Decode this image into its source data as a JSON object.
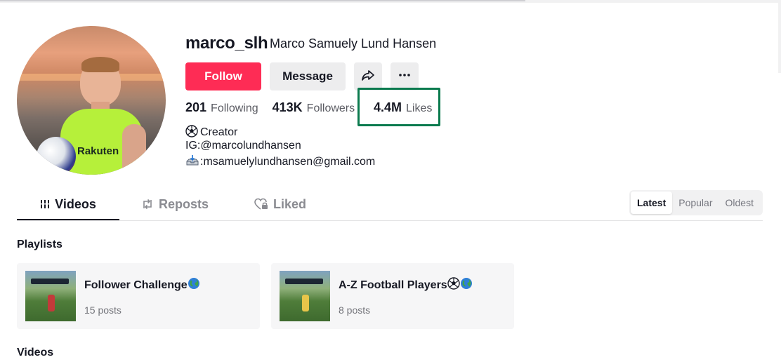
{
  "profile": {
    "username": "marco_slh",
    "display_name": "Marco Samuely Lund Hansen",
    "buttons": {
      "follow": "Follow",
      "message": "Message"
    },
    "stats": {
      "following": {
        "value": "201",
        "label": "Following"
      },
      "followers": {
        "value": "413K",
        "label": "Followers"
      },
      "likes": {
        "value": "4.4M",
        "label": "Likes"
      }
    },
    "bio": {
      "line1": "Creator",
      "line2": "IG:@marcolundhansen",
      "line3": ":msamuelylundhansen@gmail.com"
    },
    "avatar_text": "Rakuten"
  },
  "tabs": {
    "videos": "Videos",
    "reposts": "Reposts",
    "liked": "Liked"
  },
  "sort": {
    "latest": "Latest",
    "popular": "Popular",
    "oldest": "Oldest",
    "selected": "Latest"
  },
  "sections": {
    "playlists": "Playlists",
    "videos": "Videos"
  },
  "playlists": [
    {
      "name": "Follower Challenge",
      "count": "15 posts"
    },
    {
      "name": "A-Z Football Players",
      "count": "8 posts"
    }
  ],
  "colors": {
    "accent": "#fe2c55",
    "highlight": "#0b7a4e"
  }
}
